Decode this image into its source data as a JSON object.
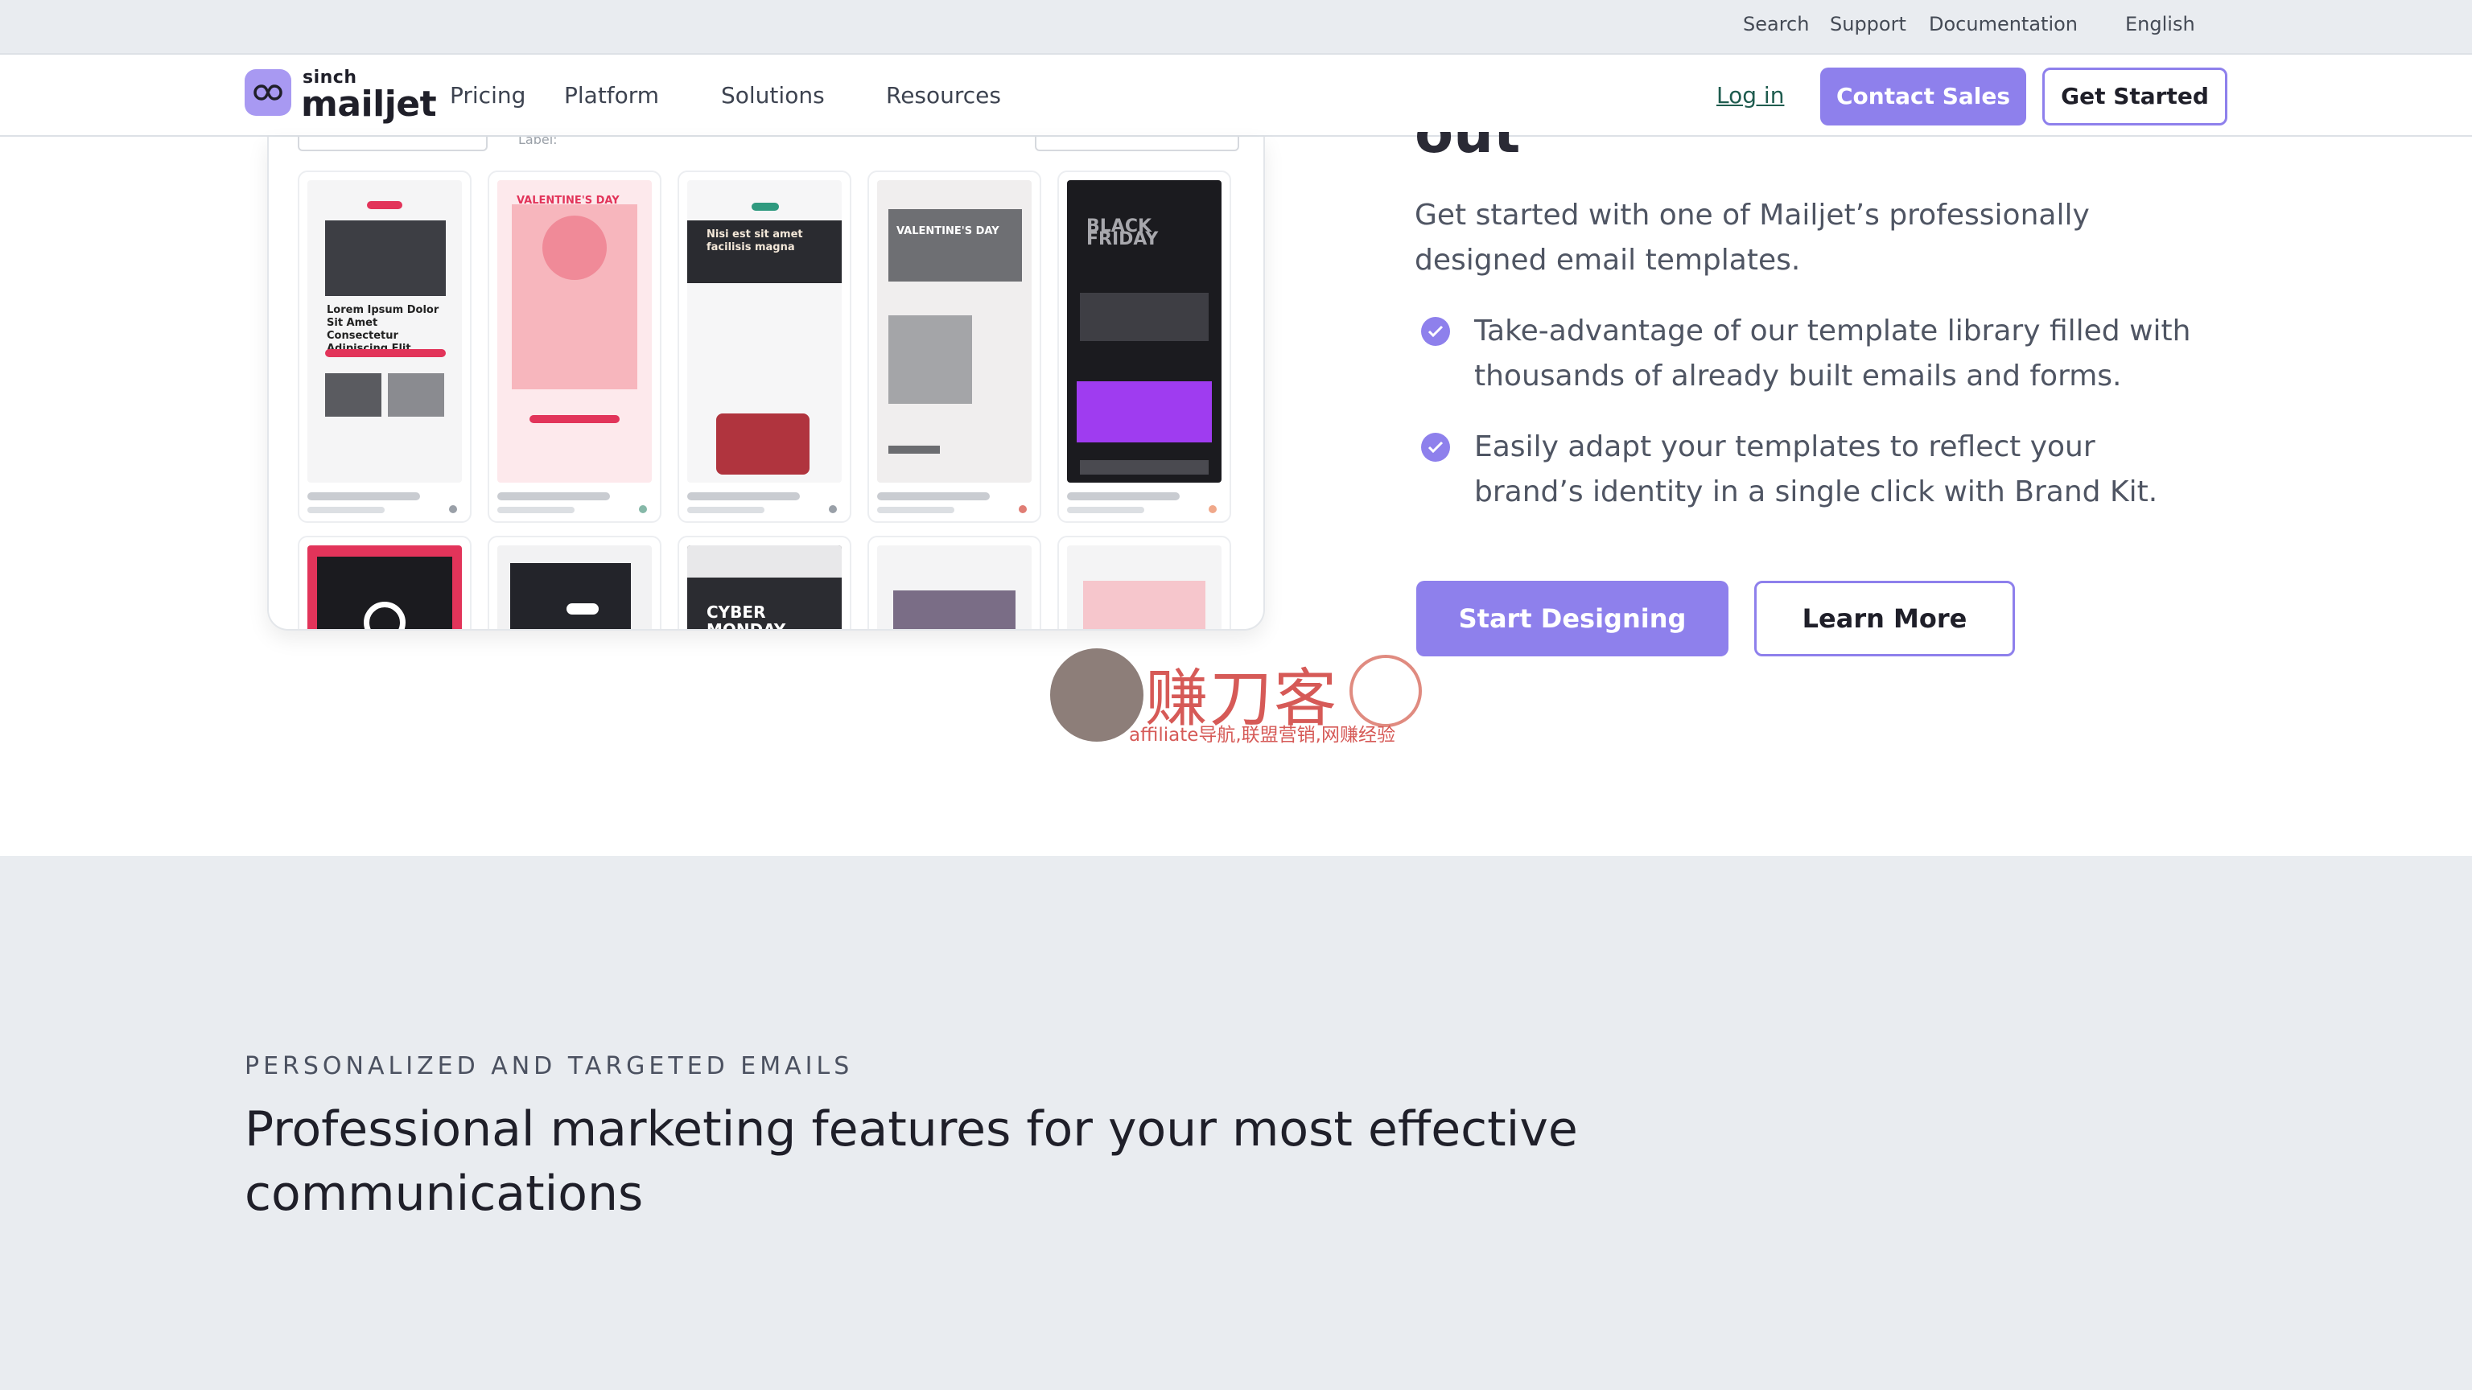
{
  "utility": {
    "search": "Search",
    "support": "Support",
    "documentation": "Documentation",
    "language": "English"
  },
  "brand": {
    "sub": "sinch",
    "name": "mailjet",
    "accent": "#8e80ec"
  },
  "nav": {
    "pricing": "Pricing",
    "platform": "Platform",
    "solutions": "Solutions",
    "resources": "Resources",
    "login": "Log in",
    "contact": "Contact Sales",
    "get_started": "Get Started"
  },
  "hero": {
    "title_fragment": "out",
    "description": "Get started with one of Mailjet’s professionally designed email templates.",
    "features": [
      "Take-advantage of our template library filled with thousands of already built emails and forms.",
      "Easily adapt your templates to reflect your brand’s identity in a single click with Brand Kit."
    ],
    "cta_primary": "Start Designing",
    "cta_secondary": "Learn More"
  },
  "templates": {
    "label": "Label:",
    "items": [
      {
        "name": "Lorem Ipsum Dolor Sit Amet Consectetur Adipiscing Elit"
      },
      {
        "name": "VALENTINE'S DAY"
      },
      {
        "name": "Nisi est sit amet facilisis magna"
      },
      {
        "name": "VALENTINE'S DAY"
      },
      {
        "name": "BLACK FRIDAY"
      },
      {
        "name": ""
      },
      {
        "name": ""
      },
      {
        "name": "CYBER MONDAY"
      },
      {
        "name": ""
      },
      {
        "name": ""
      }
    ]
  },
  "watermark": {
    "title": "赚刀客",
    "subtitle": "affiliate导航,联盟营销,网赚经验"
  },
  "section2": {
    "eyebrow": "PERSONALIZED AND TARGETED EMAILS",
    "title": "Professional marketing features for your most effective communications"
  }
}
